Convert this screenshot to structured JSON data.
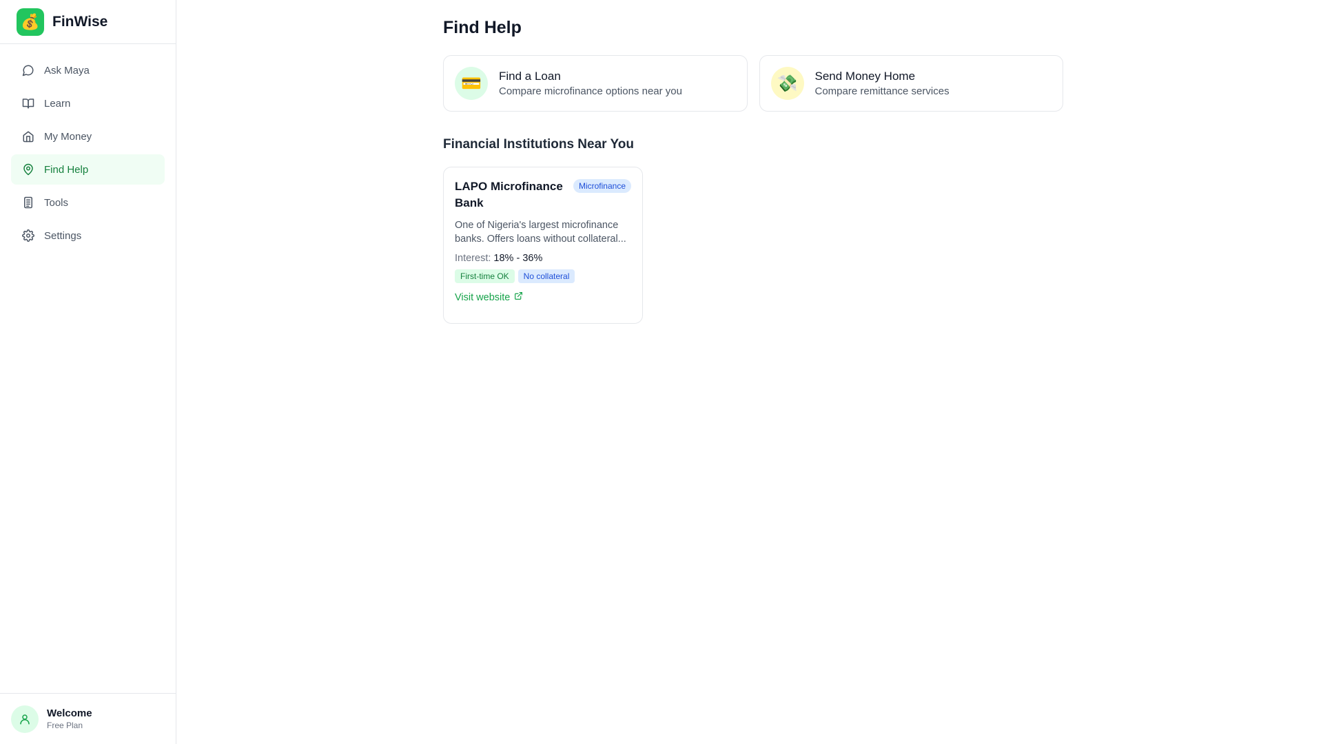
{
  "brand": {
    "name": "FinWise",
    "logo_icon": "money-bag-icon",
    "logo_glyph": "💰",
    "accent": "#22c55e"
  },
  "sidebar": {
    "items": [
      {
        "label": "Ask Maya",
        "icon": "chat-bubble-icon",
        "active": false
      },
      {
        "label": "Learn",
        "icon": "book-icon",
        "active": false
      },
      {
        "label": "My Money",
        "icon": "home-icon",
        "active": false
      },
      {
        "label": "Find Help",
        "icon": "map-pin-icon",
        "active": true
      },
      {
        "label": "Tools",
        "icon": "calculator-icon",
        "active": false
      },
      {
        "label": "Settings",
        "icon": "gear-icon",
        "active": false
      }
    ],
    "user": {
      "name": "Welcome",
      "plan": "Free Plan",
      "icon": "user-icon"
    }
  },
  "main": {
    "title": "Find Help",
    "actions": [
      {
        "title": "Find a Loan",
        "subtitle": "Compare microfinance options near you",
        "icon": "credit-card-icon",
        "glyph": "💳",
        "bg": "#dcfce7"
      },
      {
        "title": "Send Money Home",
        "subtitle": "Compare remittance services",
        "icon": "money-wings-icon",
        "glyph": "💸",
        "bg": "#fef9c3"
      }
    ],
    "section_title": "Financial Institutions Near You",
    "institutions": [
      {
        "name": "LAPO Microfinance Bank",
        "type": "Microfinance",
        "description": "One of Nigeria's largest microfinance banks. Offers loans without collateral...",
        "interest_label": "Interest:",
        "interest_value": "18% - 36%",
        "tags": [
          "First-time OK",
          "No collateral"
        ],
        "link_label": "Visit website",
        "link_icon": "external-link-icon"
      }
    ]
  }
}
